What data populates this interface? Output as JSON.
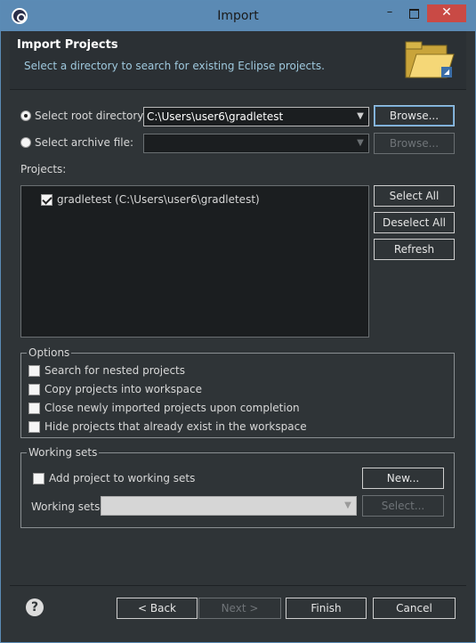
{
  "window": {
    "title": "Import",
    "minimize_label": "–",
    "close_label": "✕"
  },
  "header": {
    "title": "Import Projects",
    "description": "Select a directory to search for existing Eclipse projects."
  },
  "source": {
    "root_dir_label": "Select root directory:",
    "root_dir_value": "C:\\Users\\user6\\gradletest",
    "archive_label": "Select archive file:",
    "archive_value": "",
    "browse_label": "Browse...",
    "browse_disabled_label": "Browse..."
  },
  "projects": {
    "label": "Projects:",
    "items": [
      {
        "label": "gradletest (C:\\Users\\user6\\gradletest)",
        "checked": true
      }
    ],
    "select_all": "Select All",
    "deselect_all": "Deselect All",
    "refresh": "Refresh"
  },
  "options": {
    "title": "Options",
    "items": [
      "Search for nested projects",
      "Copy projects into workspace",
      "Close newly imported projects upon completion",
      "Hide projects that already exist in the workspace"
    ]
  },
  "working_sets": {
    "title": "Working sets",
    "add_label": "Add project to working sets",
    "sets_label": "Working sets:",
    "new_label": "New...",
    "select_label": "Select..."
  },
  "footer": {
    "help_label": "?",
    "back": "< Back",
    "next": "Next >",
    "finish": "Finish",
    "cancel": "Cancel"
  }
}
